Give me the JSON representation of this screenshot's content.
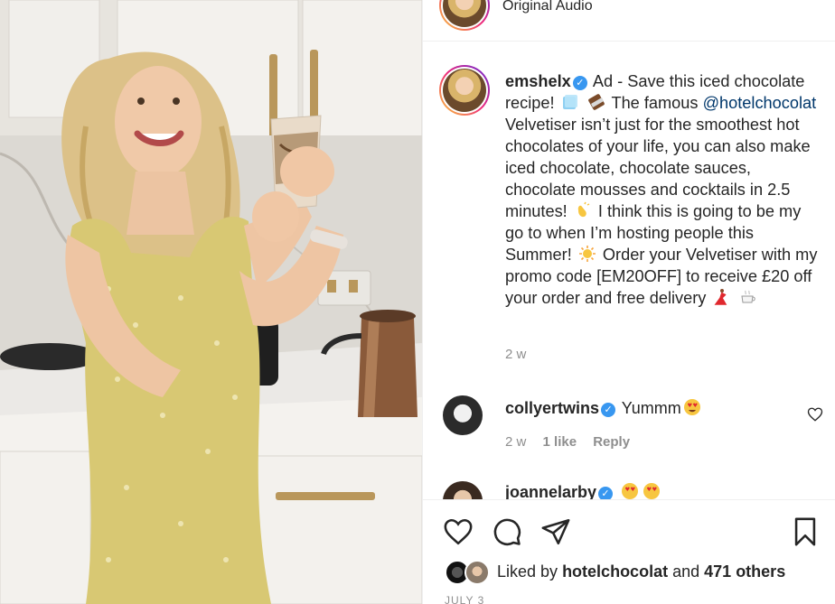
{
  "post": {
    "original_audio": "Original Audio",
    "author": "emshelx",
    "caption_parts": {
      "p1": "Ad - Save this iced chocolate recipe!",
      "p2": "The famous",
      "mention": "@hotelchocolat",
      "p3": "Velvetiser isn’t just for the smoothest hot chocolates of your life, you can also make iced chocolate, chocolate sauces, chocolate mousses and cocktails in 2.5 minutes!",
      "p4": "I think this is going to be my go to when I’m hosting people this Summer!",
      "p5": "Order your Velvetiser with my promo code [EM20OFF] to receive £20 off your order and free delivery"
    },
    "time_ago": "2 w"
  },
  "comments": [
    {
      "username": "collyertwins",
      "text": "Yummm",
      "time": "2 w",
      "likes": "1 like",
      "reply": "Reply"
    },
    {
      "username": "joannelarby",
      "text": ""
    }
  ],
  "likes_bar": {
    "prefix": "Liked by",
    "user": "hotelchocolat",
    "middle": "and",
    "count": "471 others"
  },
  "date": "JULY 3",
  "icons": {
    "like": "heart-icon",
    "comment": "comment-icon",
    "share": "share-icon",
    "save": "bookmark-icon"
  }
}
